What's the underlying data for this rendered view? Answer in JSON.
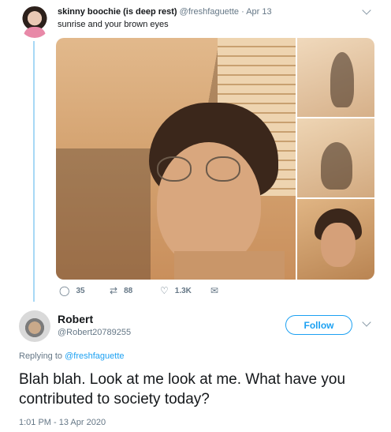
{
  "original_tweet": {
    "display_name": "skinny boochie (is deep rest)",
    "handle": "@freshfaguette",
    "date": "· Apr 13",
    "text": "sunrise and your brown eyes",
    "actions": {
      "reply": {
        "icon": "speech-bubble-icon",
        "count": "35"
      },
      "retweet": {
        "icon": "retweet-icon",
        "count": "88"
      },
      "like": {
        "icon": "heart-icon",
        "count": "1.3K"
      },
      "message": {
        "icon": "envelope-icon"
      }
    }
  },
  "reply_tweet": {
    "display_name": "Robert",
    "handle": "@Robert20789255",
    "follow_label": "Follow",
    "replying_prefix": "Replying to",
    "replying_handle": "@freshfaguette",
    "text": "Blah blah. Look at me look at me. What have you contributed to society today?",
    "timestamp": "1:01 PM - 13 Apr 2020"
  },
  "colors": {
    "accent": "#1da1f2",
    "thread_line": "#a7d8f5",
    "secondary_text": "#657786"
  }
}
